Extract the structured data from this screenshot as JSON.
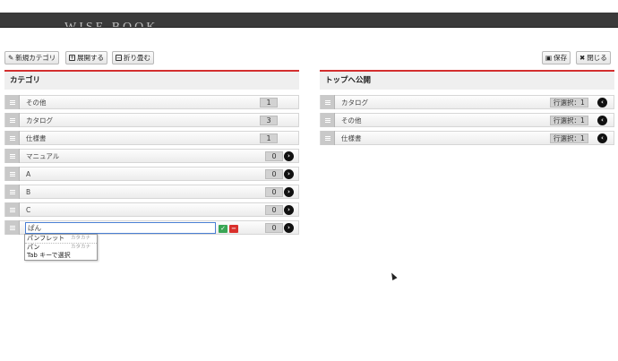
{
  "header": {
    "logo_text": "WISE BOOK"
  },
  "toolbar": {
    "new_category": "新規カテゴリ",
    "expand": "展開する",
    "collapse": "折り畳む",
    "save": "保存",
    "close": "閉じる"
  },
  "left_panel": {
    "title": "カテゴリ",
    "items": [
      {
        "label": "その他",
        "count": "1"
      },
      {
        "label": "カタログ",
        "count": "3"
      },
      {
        "label": "仕様書",
        "count": "1"
      },
      {
        "label": "マニュアル",
        "count": "0"
      },
      {
        "label": "A",
        "count": "0"
      },
      {
        "label": "B",
        "count": "0"
      },
      {
        "label": "C",
        "count": "0"
      }
    ],
    "editing_item": {
      "value": "ぱん",
      "count": "0"
    }
  },
  "ime_popup": {
    "candidates": [
      {
        "text": "パンフレット",
        "kind": "カタカナ"
      },
      {
        "text": "パン",
        "kind": "カタカナ"
      }
    ],
    "hint": "Tab キーで選択"
  },
  "right_panel": {
    "title": "トップへ公開",
    "items": [
      {
        "label": "カタログ",
        "badge": "行選択：1"
      },
      {
        "label": "その他",
        "badge": "行選択：1"
      },
      {
        "label": "仕様書",
        "badge": "行選択：1"
      }
    ]
  },
  "colors": {
    "accent_red": "#d32f2f",
    "confirm_green": "#3aa655",
    "cancel_red": "#d9302c",
    "input_border": "#4a7fd4"
  },
  "icons": {
    "new_category": "pencil-icon",
    "expand": "plus-box-icon",
    "collapse": "minus-box-icon",
    "save": "floppy-disk-icon",
    "close": "close-circle-icon",
    "row_handle": "drag-handle-icon",
    "row_arrow": "chevron-circle-right-icon",
    "right_row_arrow": "chevron-circle-left-icon"
  }
}
